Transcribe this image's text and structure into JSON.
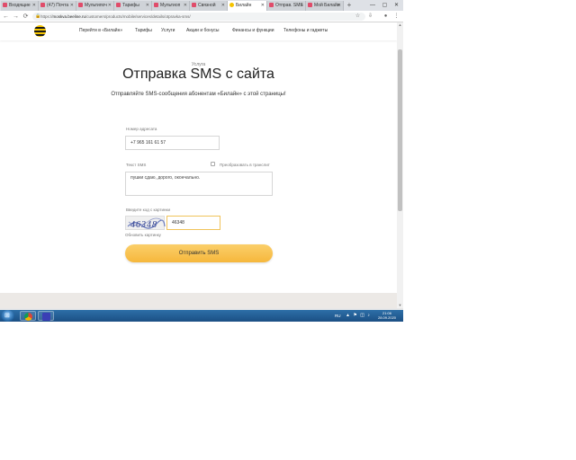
{
  "browser": {
    "tabs": [
      {
        "label": "Входящие"
      },
      {
        "label": "(47) Почта"
      },
      {
        "label": "Мультипоч"
      },
      {
        "label": "Тарифы"
      },
      {
        "label": "Мультиоп"
      },
      {
        "label": "Связной"
      },
      {
        "label": "Билайн",
        "active": true
      },
      {
        "label": "Отправ. SMS"
      },
      {
        "label": "Мой Билайн"
      }
    ],
    "tab_close": "✕",
    "new_tab": "+",
    "window_controls": "— ▢ ✕",
    "back": "←",
    "forward": "→",
    "reload": "⟳",
    "url_prefix": "https://",
    "url_host": "moskva.beeline.ru",
    "url_path": "/customers/products/mobile/services/details/otpravka-sms/",
    "star": "☆",
    "ext": "⇩",
    "profile": "●",
    "menu": "⋮"
  },
  "site": {
    "nav": [
      "Перейти в «Билайн»",
      "Тарифы",
      "Услуги",
      "Акции и бонусы",
      "Финансы и функции",
      "Телефоны и гаджеты"
    ]
  },
  "page": {
    "eyebrow": "Услуга",
    "title": "Отправка SMS с сайта",
    "subtitle": "Отправляйте SMS-сообщения абонентам «Билайн» с этой страницы!",
    "phone_label": "Номер адресата",
    "phone_value": "+7 965 161 61 57",
    "sms_label": "Текст SMS",
    "translit_label": "Преобразовать в транслит",
    "sms_value": "пушки сдаю, дорого, окончально.",
    "captcha_label": "Введите код с картинки",
    "captcha_text": "46348",
    "captcha_value": "46348",
    "change_picture": "Обновить картинку",
    "send_button": "Отправить SMS"
  },
  "taskbar": {
    "start_glyph": "⊞",
    "lang": "RU",
    "tray_icons": "▲ ⚑ ◫ ♪",
    "time": "21:06",
    "date": "28.09.2020"
  },
  "colors": {
    "accent": "#f6b73c",
    "brand_yellow": "#f7c600",
    "taskbar": "#1b4f84"
  }
}
